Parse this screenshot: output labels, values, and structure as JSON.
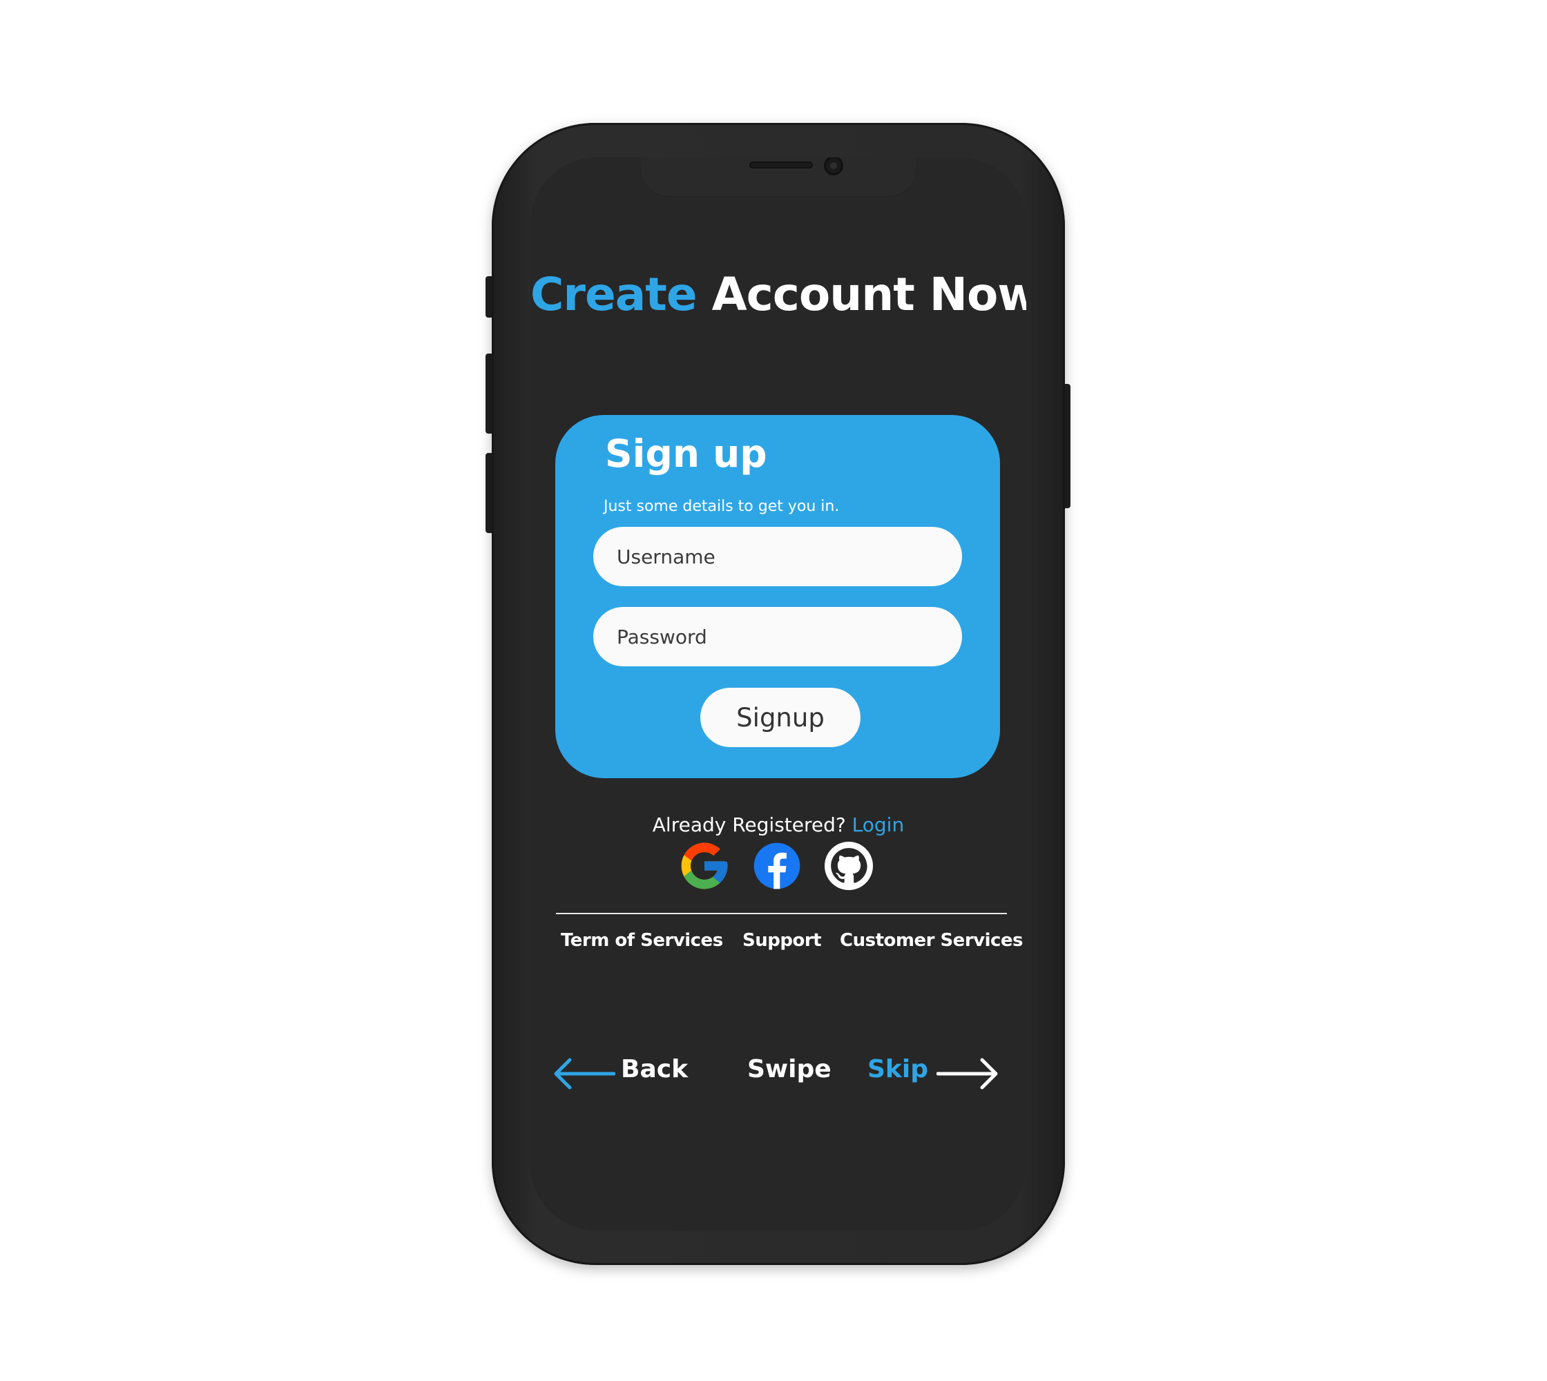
{
  "header": {
    "title_accent": "Create",
    "title_rest": "Account Now"
  },
  "signup_card": {
    "title": "Sign up",
    "subtitle": "Just some details to get you in.",
    "username_placeholder": "Username",
    "password_placeholder": "Password",
    "button_label": "Signup"
  },
  "login_prompt": {
    "text": "Already Registered?",
    "link_label": "Login"
  },
  "social_logins": [
    {
      "icon": "google-icon"
    },
    {
      "icon": "facebook-icon"
    },
    {
      "icon": "github-icon"
    }
  ],
  "footer": {
    "links": [
      "Term of Services",
      "Support",
      "Customer Services"
    ]
  },
  "navigation": {
    "back_label": "Back",
    "swipe_label": "Swipe",
    "skip_label": "Skip"
  },
  "colors": {
    "accent": "#2fa5e6",
    "card": "#2ea6e6",
    "screen_background": "#272727",
    "phone_frame": "#2a2a2a",
    "google_blue": "#4285F4",
    "google_red": "#EA4335",
    "google_yellow": "#FBBC05",
    "google_green": "#34A853",
    "facebook_blue": "#1877F2"
  }
}
